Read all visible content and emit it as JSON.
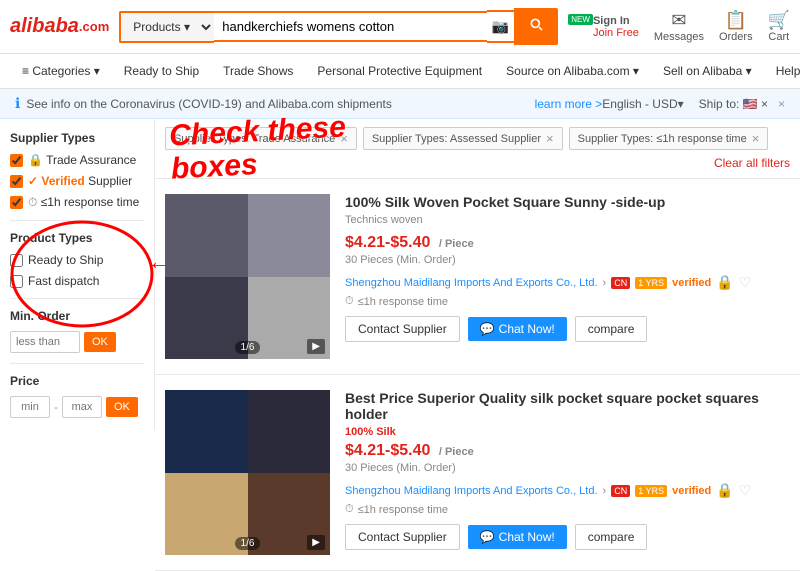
{
  "header": {
    "logo": "Alibaba.com",
    "search_placeholder": "handkerchiefs womens cotton",
    "search_select": "Products",
    "new_badge": "NEW",
    "actions": {
      "signin": "Sign In",
      "join_free": "Join Free",
      "messages": "Messages",
      "orders": "Orders",
      "cart": "Cart"
    }
  },
  "nav": {
    "items": [
      "≡  Categories ▾",
      "Ready to Ship",
      "Trade Shows",
      "Personal Protective Equipment",
      "Source on Alibaba.com ▾",
      "Sell on Alibaba ▾",
      "Help ▾"
    ]
  },
  "alert": {
    "text": "See info on the Coronavirus (COVID-19) and Alibaba.com shipments",
    "learn_more": "learn more  >",
    "language": "English - USD▾",
    "ship_to": "Ship to: 🇺🇸 ×"
  },
  "sidebar": {
    "supplier_types_title": "Supplier Types",
    "filters": [
      {
        "id": "trade",
        "label": "Trade Assurance",
        "badge": "🔒",
        "checked": true
      },
      {
        "id": "verified",
        "label": "Verified Supplier",
        "checked": true
      },
      {
        "id": "response",
        "label": "≤1h response time",
        "checked": true
      }
    ],
    "product_types_title": "Product Types",
    "product_filters": [
      {
        "id": "rts",
        "label": "Ready to Ship",
        "checked": false
      },
      {
        "id": "fast",
        "label": "Fast dispatch",
        "checked": false
      }
    ],
    "min_order_title": "Min. Order",
    "min_order_placeholder": "less than",
    "ok_btn": "OK",
    "price_title": "Price",
    "price_min": "min",
    "price_max": "max",
    "price_ok": "OK"
  },
  "filter_tags": [
    {
      "label": "Supplier Types: Trade Assurance"
    },
    {
      "label": "Supplier Types: Assessed Supplier"
    },
    {
      "label": "Supplier Types: ≤1h response time"
    }
  ],
  "clear_filters": "Clear all filters",
  "products": [
    {
      "title": "100% Silk Woven Pocket Square Sunny -side-up",
      "subtitle": "Technics woven",
      "price": "$4.21-$5.40",
      "price_unit": "/ Piece",
      "moq": "30 Pieces (Min. Order)",
      "supplier": "Shengzhou Maidilang Imports And Exports Co., Ltd.",
      "country": "CN",
      "years": "1 YRS",
      "verified": "verified",
      "response": "≤1h response time",
      "btn_contact": "Contact Supplier",
      "btn_chat": "Chat Now!",
      "btn_compare": "compare",
      "indicator": "1/6"
    },
    {
      "title": "Best Price Superior Quality silk pocket square pocket squares holder",
      "subtitle": "100% Silk",
      "price": "$4.21-$5.40",
      "price_unit": "/ Piece",
      "moq": "30 Pieces (Min. Order)",
      "supplier": "Shengzhou Maidilang Imports And Exports Co., Ltd.",
      "country": "CN",
      "years": "1 YRS",
      "verified": "verified",
      "response": "≤1h response time",
      "btn_contact": "Contact Supplier",
      "btn_chat": "Chat Now!",
      "btn_compare": "compare",
      "indicator": "1/6"
    }
  ],
  "annotation": {
    "text": "Check these\nboxes"
  },
  "icons": {
    "camera": "📷",
    "search": "🔍",
    "messages": "✉",
    "orders": "📋",
    "cart": "🛒",
    "person": "👤",
    "shield": "🔒",
    "chat_bubble": "💬",
    "clock": "⏱",
    "flag_us": "🇺🇸"
  }
}
